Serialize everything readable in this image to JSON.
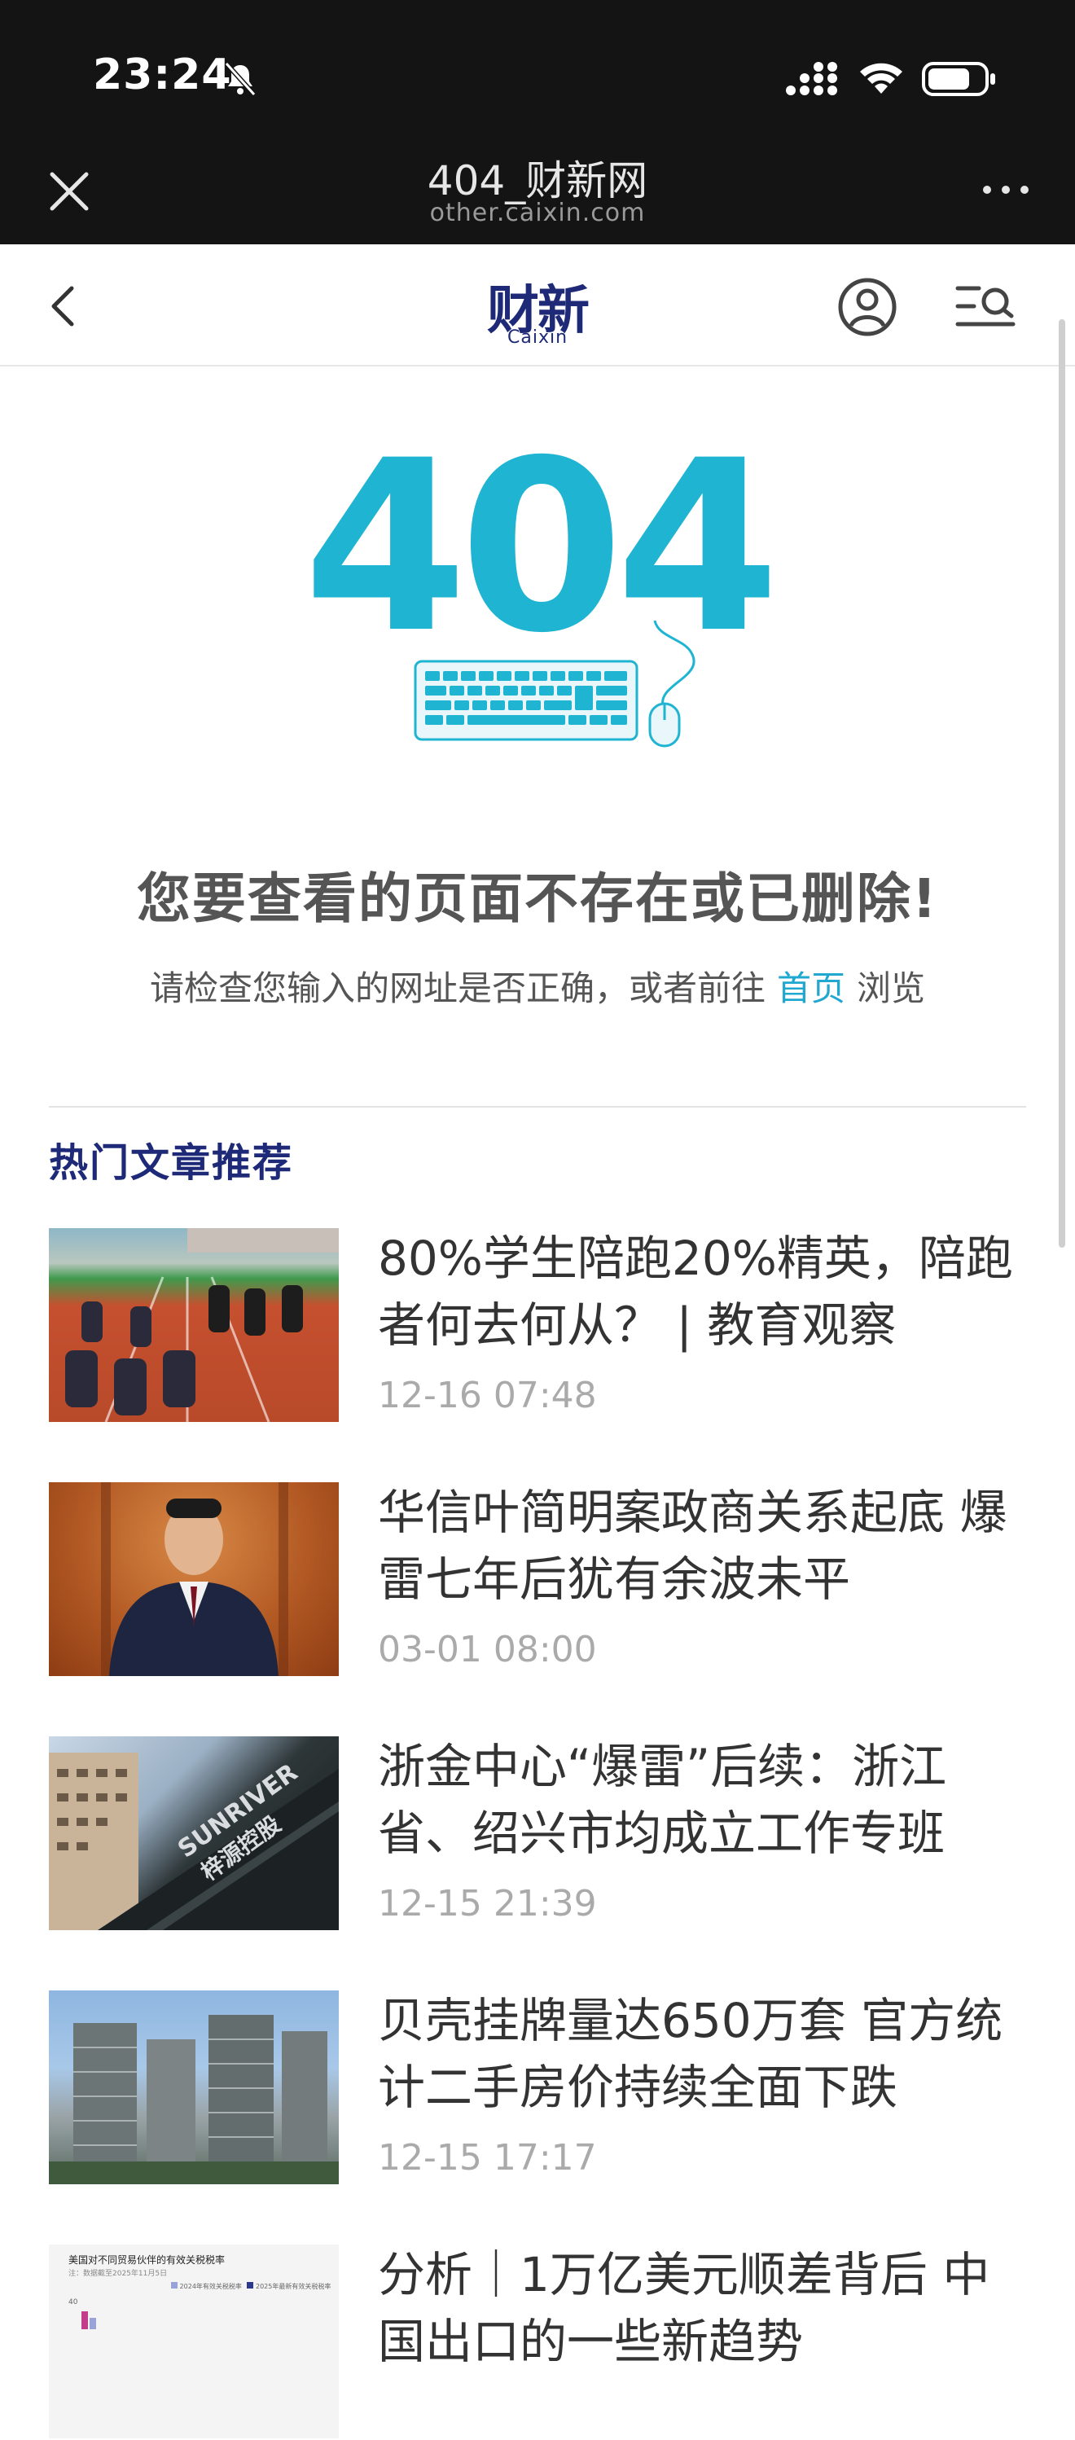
{
  "status_bar": {
    "time": "23:24"
  },
  "webview": {
    "title": "404_财新网",
    "domain": "other.caixin.com"
  },
  "site_nav": {
    "logo_cn": "财新",
    "logo_en": "Caixin"
  },
  "error": {
    "code": "404",
    "title": "您要查看的页面不存在或已删除!",
    "sub_before": "请检查您输入的网址是否正确，或者前往",
    "home_link": "首页",
    "sub_after": "浏览"
  },
  "hot": {
    "section_title": "热门文章推荐",
    "articles": [
      {
        "title": "80%学生陪跑20%精英，陪跑者何去何从？ | 教育观察",
        "time": "12-16 07:48"
      },
      {
        "title": "华信叶简明案政商关系起底 爆雷七年后犹有余波未平",
        "time": "03-01 08:00"
      },
      {
        "title": "浙金中心“爆雷”后续：浙江省、绍兴市均成立工作专班",
        "time": "12-15 21:39"
      },
      {
        "title": "贝壳挂牌量达650万套 官方统计二手房价持续全面下跌",
        "time": "12-15 17:17"
      },
      {
        "title": "分析｜1万亿美元顺差背后 中国出口的一些新趋势",
        "time": ""
      }
    ]
  },
  "thumb5": {
    "caption": "美国对不同贸易伙伴的有效关税税率",
    "note": "注：数据截至2025年11月5日",
    "legend_a": "2024年有效关税税率",
    "legend_b": "2025年最新有效关税税率",
    "axis_val": "40"
  },
  "colors": {
    "header_bg": "#141414",
    "brand_navy": "#1e2a78",
    "accent_cyan": "#1fb4d2",
    "link_blue": "#20a8d0"
  }
}
